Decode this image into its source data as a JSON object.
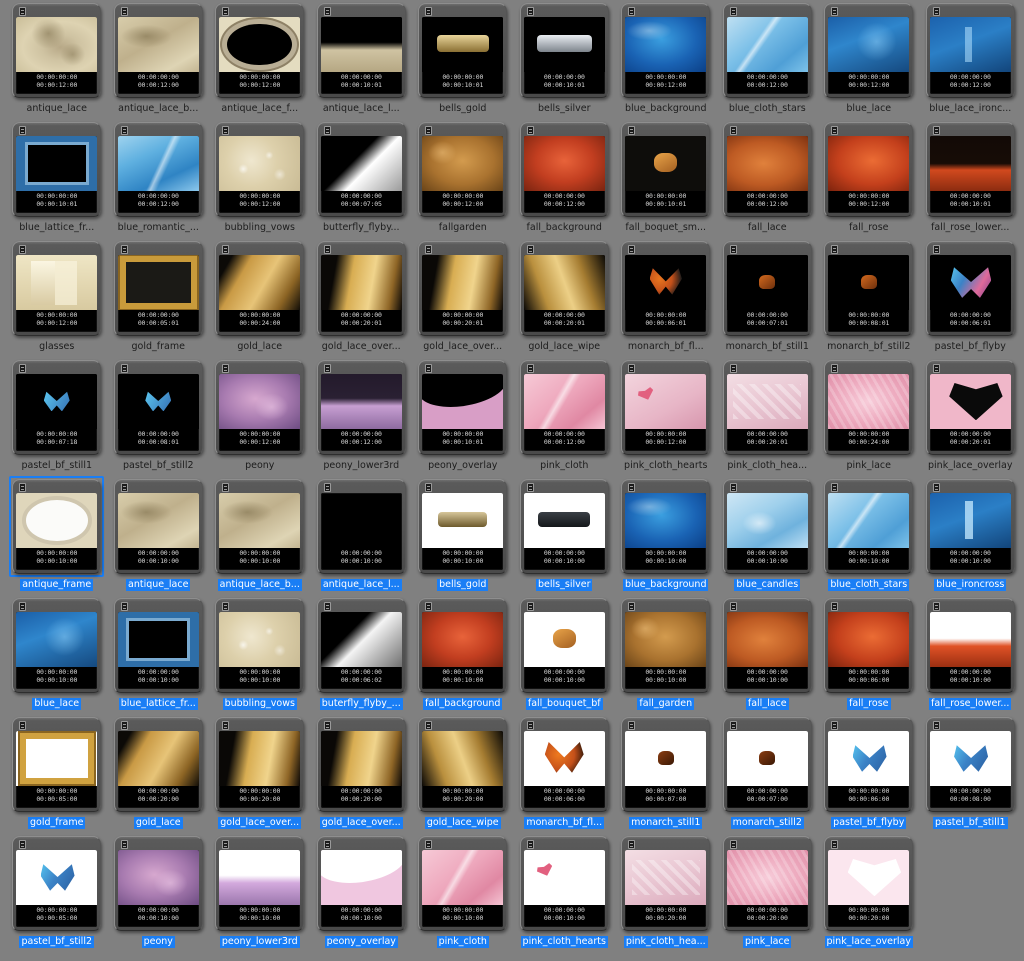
{
  "app": {
    "view": "thumbnail-grid",
    "background_color": "#808080",
    "selection_color": "#1a7ef5",
    "columns": 10
  },
  "rows": [
    {
      "selected": false,
      "items": [
        {
          "label": "antique_lace",
          "tc_in": "00:00:00:00",
          "tc_dur": "00:00:12:00",
          "art": "t-lace"
        },
        {
          "label": "antique_lace_b...",
          "tc_in": "00:00:00:00",
          "tc_dur": "00:00:12:00",
          "art": "t-lace2"
        },
        {
          "label": "antique_lace_f...",
          "tc_in": "00:00:00:00",
          "tc_dur": "00:00:12:00",
          "art": "t-lacefrm"
        },
        {
          "label": "antique_lace_l...",
          "tc_in": "00:00:00:00",
          "tc_dur": "00:00:10:01",
          "art": "t-lacelower"
        },
        {
          "label": "bells_gold",
          "tc_in": "00:00:00:00",
          "tc_dur": "00:00:10:01",
          "art": "t-bells"
        },
        {
          "label": "bells_silver",
          "tc_in": "00:00:00:00",
          "tc_dur": "00:00:10:01",
          "art": "t-bellsS"
        },
        {
          "label": "blue_background",
          "tc_in": "00:00:00:00",
          "tc_dur": "00:00:12:00",
          "art": "t-bluebg"
        },
        {
          "label": "blue_cloth_stars",
          "tc_in": "00:00:00:00",
          "tc_dur": "00:00:12:00",
          "art": "t-bluecloth"
        },
        {
          "label": "blue_lace",
          "tc_in": "00:00:00:00",
          "tc_dur": "00:00:12:00",
          "art": "t-bluelace"
        },
        {
          "label": "blue_lace_ironc...",
          "tc_in": "00:00:00:00",
          "tc_dur": "00:00:12:00",
          "art": "t-blueiron"
        }
      ]
    },
    {
      "selected": false,
      "items": [
        {
          "label": "blue_lattice_fr...",
          "tc_in": "00:00:00:00",
          "tc_dur": "00:00:10:01",
          "art": "t-bluelat"
        },
        {
          "label": "blue_romantic_...",
          "tc_in": "00:00:00:00",
          "tc_dur": "00:00:12:00",
          "art": "t-blueromantic"
        },
        {
          "label": "bubbling_vows",
          "tc_in": "00:00:00:00",
          "tc_dur": "00:00:12:00",
          "art": "t-bubbling"
        },
        {
          "label": "butterfly_flyby...",
          "tc_in": "00:00:00:00",
          "tc_dur": "00:00:07:05",
          "art": "t-butterflyG"
        },
        {
          "label": "fallgarden",
          "tc_in": "00:00:00:00",
          "tc_dur": "00:00:12:00",
          "art": "t-fallgarden"
        },
        {
          "label": "fall_background",
          "tc_in": "00:00:00:00",
          "tc_dur": "00:00:12:00",
          "art": "t-fallbg"
        },
        {
          "label": "fall_boquet_sm...",
          "tc_in": "00:00:00:00",
          "tc_dur": "00:00:10:01",
          "art": "t-fallbq"
        },
        {
          "label": "fall_lace",
          "tc_in": "00:00:00:00",
          "tc_dur": "00:00:12:00",
          "art": "t-fallace"
        },
        {
          "label": "fall_rose",
          "tc_in": "00:00:00:00",
          "tc_dur": "00:00:12:00",
          "art": "t-fallrose"
        },
        {
          "label": "fall_rose_lower...",
          "tc_in": "00:00:00:00",
          "tc_dur": "00:00:10:01",
          "art": "t-fallrlower"
        }
      ]
    },
    {
      "selected": false,
      "items": [
        {
          "label": "glasses",
          "tc_in": "00:00:00:00",
          "tc_dur": "00:00:12:00",
          "art": "t-glasses"
        },
        {
          "label": "gold_frame",
          "tc_in": "00:00:00:00",
          "tc_dur": "00:00:05:01",
          "art": "t-goldframe"
        },
        {
          "label": "gold_lace",
          "tc_in": "00:00:00:00",
          "tc_dur": "00:00:24:00",
          "art": "t-goldlace"
        },
        {
          "label": "gold_lace_over...",
          "tc_in": "00:00:00:00",
          "tc_dur": "00:00:20:01",
          "art": "t-goldlace2"
        },
        {
          "label": "gold_lace_over...",
          "tc_in": "00:00:00:00",
          "tc_dur": "00:00:20:01",
          "art": "t-goldlace2"
        },
        {
          "label": "gold_lace_wipe",
          "tc_in": "00:00:00:00",
          "tc_dur": "00:00:20:01",
          "art": "t-goldwipe"
        },
        {
          "label": "monarch_bf_fl...",
          "tc_in": "00:00:00:00",
          "tc_dur": "00:00:06:01",
          "art": "t-monarch"
        },
        {
          "label": "monarch_bf_still1",
          "tc_in": "00:00:00:00",
          "tc_dur": "00:00:07:01",
          "art": "t-monarchS"
        },
        {
          "label": "monarch_bf_still2",
          "tc_in": "00:00:00:00",
          "tc_dur": "00:00:08:01",
          "art": "t-monarchS"
        },
        {
          "label": "pastel_bf_flyby",
          "tc_in": "00:00:00:00",
          "tc_dur": "00:00:06:01",
          "art": "t-pastelbf"
        }
      ]
    },
    {
      "selected": false,
      "items": [
        {
          "label": "pastel_bf_still1",
          "tc_in": "00:00:00:00",
          "tc_dur": "00:00:07:18",
          "art": "t-pastels1"
        },
        {
          "label": "pastel_bf_still2",
          "tc_in": "00:00:00:00",
          "tc_dur": "00:00:08:01",
          "art": "t-pastels1"
        },
        {
          "label": "peony",
          "tc_in": "00:00:00:00",
          "tc_dur": "00:00:12:00",
          "art": "t-peony"
        },
        {
          "label": "peony_lower3rd",
          "tc_in": "00:00:00:00",
          "tc_dur": "00:00:12:00",
          "art": "t-peonylower"
        },
        {
          "label": "peony_overlay",
          "tc_in": "00:00:00:00",
          "tc_dur": "00:00:10:01",
          "art": "t-peonyov"
        },
        {
          "label": "pink_cloth",
          "tc_in": "00:00:00:00",
          "tc_dur": "00:00:12:00",
          "art": "t-pinkcloth"
        },
        {
          "label": "pink_cloth_hearts",
          "tc_in": "00:00:00:00",
          "tc_dur": "00:00:12:00",
          "art": "t-pinkhearts"
        },
        {
          "label": "pink_cloth_hea...",
          "tc_in": "00:00:00:00",
          "tc_dur": "00:00:20:01",
          "art": "t-pinkhea2"
        },
        {
          "label": "pink_lace",
          "tc_in": "00:00:00:00",
          "tc_dur": "00:00:24:00",
          "art": "t-pinklace"
        },
        {
          "label": "pink_lace_overlay",
          "tc_in": "00:00:00:00",
          "tc_dur": "00:00:20:01",
          "art": "t-pinkov"
        }
      ]
    },
    {
      "selected": true,
      "items": [
        {
          "label": "antique_frame",
          "tc_in": "00:00:00:00",
          "tc_dur": "00:00:10:00",
          "art": "t-antiqframe",
          "focused": true
        },
        {
          "label": "antique_lace",
          "tc_in": "00:00:00:00",
          "tc_dur": "00:00:10:00",
          "art": "t-lace2"
        },
        {
          "label": "antique_lace_b...",
          "tc_in": "00:00:00:00",
          "tc_dur": "00:00:10:00",
          "art": "t-lace2"
        },
        {
          "label": "antique_lace_l...",
          "tc_in": "00:00:00:00",
          "tc_dur": "00:00:10:00",
          "art": "t-lacelowerW"
        },
        {
          "label": "bells_gold",
          "tc_in": "00:00:00:00",
          "tc_dur": "00:00:10:00",
          "art": "t-bellsW"
        },
        {
          "label": "bells_silver",
          "tc_in": "00:00:00:00",
          "tc_dur": "00:00:10:00",
          "art": "t-bellsSW"
        },
        {
          "label": "blue_background",
          "tc_in": "00:00:00:00",
          "tc_dur": "00:00:10:00",
          "art": "t-bluebg"
        },
        {
          "label": "blue_candles",
          "tc_in": "00:00:00:00",
          "tc_dur": "00:00:10:00",
          "art": "t-bluecandles"
        },
        {
          "label": "blue_cloth_stars",
          "tc_in": "00:00:00:00",
          "tc_dur": "00:00:10:00",
          "art": "t-bluecloth"
        },
        {
          "label": "blue_ironcross",
          "tc_in": "00:00:00:00",
          "tc_dur": "00:00:10:00",
          "art": "t-blueironW"
        }
      ]
    },
    {
      "selected": true,
      "items": [
        {
          "label": "blue_lace",
          "tc_in": "00:00:00:00",
          "tc_dur": "00:00:10:00",
          "art": "t-bluelace"
        },
        {
          "label": "blue_lattice_fr...",
          "tc_in": "00:00:00:00",
          "tc_dur": "00:00:10:00",
          "art": "t-bluelat"
        },
        {
          "label": "bubbling_vows",
          "tc_in": "00:00:00:00",
          "tc_dur": "00:00:10:00",
          "art": "t-bubbling"
        },
        {
          "label": "buterfly_flyby_...",
          "tc_in": "00:00:00:00",
          "tc_dur": "00:00:06:02",
          "art": "t-butterflyG2"
        },
        {
          "label": "fall_background",
          "tc_in": "00:00:00:00",
          "tc_dur": "00:00:10:00",
          "art": "t-fallbg"
        },
        {
          "label": "fall_bouquet_bf",
          "tc_in": "00:00:00:00",
          "tc_dur": "00:00:10:00",
          "art": "t-fallbqW"
        },
        {
          "label": "fall_garden",
          "tc_in": "00:00:00:00",
          "tc_dur": "00:00:10:00",
          "art": "t-fallgarden"
        },
        {
          "label": "fall_lace",
          "tc_in": "00:00:00:00",
          "tc_dur": "00:00:10:00",
          "art": "t-fallace"
        },
        {
          "label": "fall_rose",
          "tc_in": "00:00:00:00",
          "tc_dur": "00:00:06:00",
          "art": "t-fallrose"
        },
        {
          "label": "fall_rose_lower...",
          "tc_in": "00:00:00:00",
          "tc_dur": "00:00:10:00",
          "art": "t-fallrlowerW"
        }
      ]
    },
    {
      "selected": true,
      "items": [
        {
          "label": "gold_frame",
          "tc_in": "00:00:00:00",
          "tc_dur": "00:00:05:00",
          "art": "t-goldframeW"
        },
        {
          "label": "gold_lace",
          "tc_in": "00:00:00:00",
          "tc_dur": "00:00:20:00",
          "art": "t-goldlace"
        },
        {
          "label": "gold_lace_over...",
          "tc_in": "00:00:00:00",
          "tc_dur": "00:00:20:00",
          "art": "t-goldlace2"
        },
        {
          "label": "gold_lace_over...",
          "tc_in": "00:00:00:00",
          "tc_dur": "00:00:20:00",
          "art": "t-goldlace2"
        },
        {
          "label": "gold_lace_wipe",
          "tc_in": "00:00:00:00",
          "tc_dur": "00:00:20:00",
          "art": "t-goldwipe"
        },
        {
          "label": "monarch_bf_fl...",
          "tc_in": "00:00:00:00",
          "tc_dur": "00:00:06:00",
          "art": "t-monarchW"
        },
        {
          "label": "monarch_still1",
          "tc_in": "00:00:00:00",
          "tc_dur": "00:00:07:00",
          "art": "t-monarchSW"
        },
        {
          "label": "monarch_still2",
          "tc_in": "00:00:00:00",
          "tc_dur": "00:00:07:00",
          "art": "t-monarchSW"
        },
        {
          "label": "pastel_bf_flyby",
          "tc_in": "00:00:00:00",
          "tc_dur": "00:00:06:00",
          "art": "t-pastelbfW"
        },
        {
          "label": "pastel_bf_still1",
          "tc_in": "00:00:00:00",
          "tc_dur": "00:00:08:00",
          "art": "t-pastelbfW"
        }
      ]
    },
    {
      "selected": true,
      "items": [
        {
          "label": "pastel_bf_still2",
          "tc_in": "00:00:00:00",
          "tc_dur": "00:00:05:00",
          "art": "t-pastelbfW"
        },
        {
          "label": "peony",
          "tc_in": "00:00:00:00",
          "tc_dur": "00:00:10:00",
          "art": "t-peony"
        },
        {
          "label": "peony_lower3rd",
          "tc_in": "00:00:00:00",
          "tc_dur": "00:00:10:00",
          "art": "t-peonylowerW"
        },
        {
          "label": "peony_overlay",
          "tc_in": "00:00:00:00",
          "tc_dur": "00:00:10:00",
          "art": "t-peonyovW"
        },
        {
          "label": "pink_cloth",
          "tc_in": "00:00:00:00",
          "tc_dur": "00:00:10:00",
          "art": "t-pinkcloth"
        },
        {
          "label": "pink_cloth_hearts",
          "tc_in": "00:00:00:00",
          "tc_dur": "00:00:10:00",
          "art": "t-pinkheartsW"
        },
        {
          "label": "pink_cloth_hea...",
          "tc_in": "00:00:00:00",
          "tc_dur": "00:00:20:00",
          "art": "t-pinkhea2"
        },
        {
          "label": "pink_lace",
          "tc_in": "00:00:00:00",
          "tc_dur": "00:00:20:00",
          "art": "t-pinklace"
        },
        {
          "label": "pink_lace_overlay",
          "tc_in": "00:00:00:00",
          "tc_dur": "00:00:20:00",
          "art": "t-pinkovW"
        }
      ]
    }
  ],
  "partial_top_row": {
    "selected": true,
    "note_row_index": 4
  },
  "icons": {
    "clip": "film-strip-icon"
  }
}
